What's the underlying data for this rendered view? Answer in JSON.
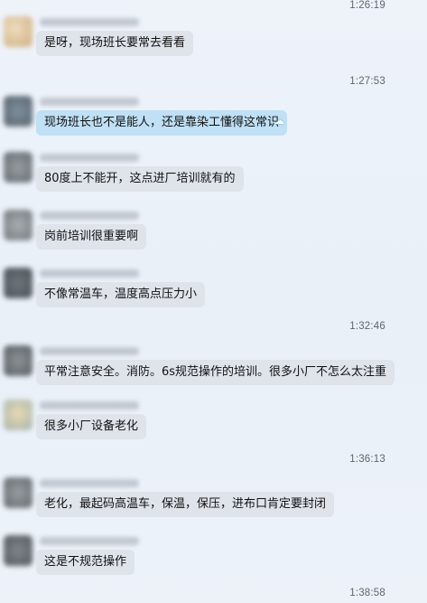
{
  "timestamps": [
    "1:26:19",
    "1:27:53",
    "1:32:46",
    "1:36:13",
    "1:38:58"
  ],
  "messages": [
    {
      "text": "是呀，现场班长要常去看看",
      "highlight": false
    },
    {
      "text": "现场班长也不是能人，还是靠染工懂得这常识",
      "highlight": true
    },
    {
      "text": "80度上不能开，这点进厂培训就有的",
      "highlight": false
    },
    {
      "text": "岗前培训很重要啊",
      "highlight": false
    },
    {
      "text": "不像常温车，温度高点压力小",
      "highlight": false
    },
    {
      "text": "平常注意安全。消防。6s规范操作的培训。很多小厂不怎么太注重",
      "highlight": false
    },
    {
      "text": "很多小厂设备老化",
      "highlight": false
    },
    {
      "text": "老化，最起码高温车，保温，保压，进布口肯定要封闭",
      "highlight": false
    },
    {
      "text": "这是不规范操作",
      "highlight": false
    }
  ],
  "colors": {
    "bubble_gray": "#dfe3ea",
    "bubble_blue": "#bfe0f5",
    "timestamp": "#5f6570"
  }
}
